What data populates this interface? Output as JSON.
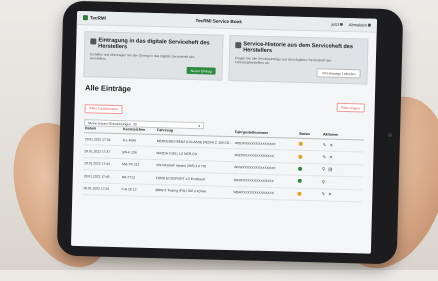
{
  "header": {
    "logo_text": "TecRMI",
    "app_title": "TecRMI Service Book",
    "user_label": "jetzt",
    "logout_label": "Abmelden"
  },
  "panel_left": {
    "title": "Eintragung in das digitale Serviceheft des Herstellers",
    "text": "Erstellen und übertragen Sie den Eintrag in das digitale Serviceheft des Herstellers.",
    "button": "Neuer Eintrag"
  },
  "panel_right": {
    "title": "Service-Historie aus dem Serviceheft des Herstellers",
    "text": "Fragen Sie alle Serviceeinträge aus dem digitalen Serviceheft des Fahrzeugherstellers ab.",
    "button": "VIN-Anzeige / Abrufen"
  },
  "entries": {
    "title": "Alle Einträge",
    "reset_button": "Filter zurücksetzen",
    "right_button": "Filter zeigen",
    "select_value": "Meine letzten Entwicklungen: 30"
  },
  "table": {
    "headers": [
      "Datum",
      "Kennzeichen",
      "Fahrzeug",
      "Fahrgestellnummer",
      "Status",
      "Aktionen"
    ],
    "rows": [
      {
        "date": "29.01.2022 17:34",
        "plate": "K-L 4656",
        "vehicle": "MERCEDES-BENZ A-KLASSE (W204) C 180 CDI (W..)",
        "vin": "WDDXXXXXXXXXXXXXXX",
        "status_color": "#e6a21a"
      },
      {
        "date": "28.01.2022 17:37",
        "plate": "BN-K 226",
        "vehicle": "MAZDA 3 (BL) 1.6 MZR-CD",
        "vin": "JMZXXXXXXXXXXXXXXX",
        "status_color": "#e6a21a"
      },
      {
        "date": "28.01.2022 17:44",
        "plate": "MG-TN 212",
        "vehicle": "VW PASSAT Variant (365) 2.0 TDI",
        "vin": "WVWXXXXXXXXXXXXXXX",
        "status_color": "#2e8b3e"
      },
      {
        "date": "28.01.2022 17:46",
        "plate": "NR-7712",
        "vehicle": "FORD ECOSPORT 1.5 EcoBoost",
        "vin": "WF0XXXXXXXXXXXXXXX",
        "status_color": "#2e8b3e"
      },
      {
        "date": "28.01.2022 17:24",
        "plate": "K-B 2K 12",
        "vehicle": "BMW 3 Touring (F31) 320 d xDrive",
        "vin": "WBAXXXXXXXXXXXXXXX",
        "status_color": "#e6a21a"
      }
    ]
  },
  "icons": {
    "logo": "tecrmi-logo-icon",
    "user": "user-icon",
    "logout": "logout-icon",
    "edit": "pencil-icon",
    "delete": "x-icon",
    "view": "magnifier-icon",
    "pdf": "document-icon"
  }
}
